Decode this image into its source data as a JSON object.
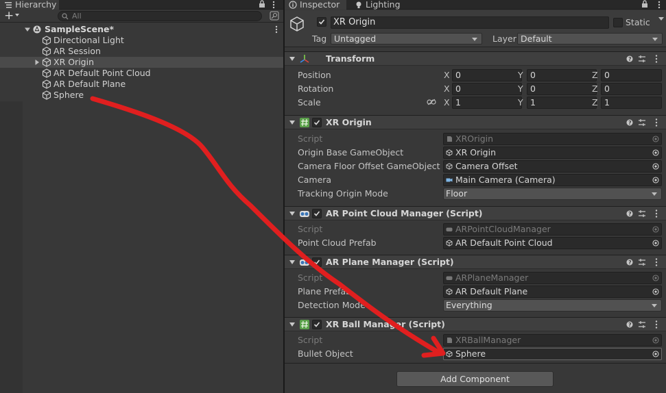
{
  "hierarchy": {
    "tab_label": "Hierarchy",
    "search_placeholder": "All",
    "scene": "SampleScene*",
    "items": [
      {
        "label": "Directional Light"
      },
      {
        "label": "AR Session"
      },
      {
        "label": "XR Origin"
      },
      {
        "label": "AR Default Point Cloud"
      },
      {
        "label": "AR Default Plane"
      },
      {
        "label": "Sphere"
      }
    ]
  },
  "inspector": {
    "tab_label": "Inspector",
    "lighting_tab_label": "Lighting",
    "object_name": "XR Origin",
    "static_label": "Static",
    "tag_label": "Tag",
    "tag_value": "Untagged",
    "layer_label": "Layer",
    "layer_value": "Default",
    "transform": {
      "title": "Transform",
      "position_label": "Position",
      "rotation_label": "Rotation",
      "scale_label": "Scale",
      "axis_x": "X",
      "axis_y": "Y",
      "axis_z": "Z",
      "position": [
        "0",
        "0",
        "0"
      ],
      "rotation": [
        "0",
        "0",
        "0"
      ],
      "scale": [
        "1",
        "1",
        "1"
      ]
    },
    "xr_origin": {
      "title": "XR Origin",
      "script_label": "Script",
      "script_value": "XROrigin",
      "base_label": "Origin Base GameObject",
      "base_value": "XR Origin",
      "floor_label": "Camera Floor Offset GameObject",
      "floor_value": "Camera Offset",
      "camera_label": "Camera",
      "camera_value": "Main Camera (Camera)",
      "mode_label": "Tracking Origin Mode",
      "mode_value": "Floor"
    },
    "point_cloud": {
      "title": "AR Point Cloud Manager (Script)",
      "script_label": "Script",
      "script_value": "ARPointCloudManager",
      "prefab_label": "Point Cloud Prefab",
      "prefab_value": "AR Default Point Cloud"
    },
    "plane": {
      "title": "AR Plane Manager (Script)",
      "script_label": "Script",
      "script_value": "ARPlaneManager",
      "prefab_label": "Plane Prefab",
      "prefab_value": "AR Default Plane",
      "detection_label": "Detection Mode",
      "detection_value": "Everything"
    },
    "ball": {
      "title": "XR Ball Manager (Script)",
      "script_label": "Script",
      "script_value": "XRBallManager",
      "bullet_label": "Bullet Object",
      "bullet_value": "Sphere"
    },
    "add_component_label": "Add Component"
  },
  "colors": {
    "background": "#383838",
    "field": "#2a2a2a",
    "annotation_arrow": "#e01f1f"
  }
}
